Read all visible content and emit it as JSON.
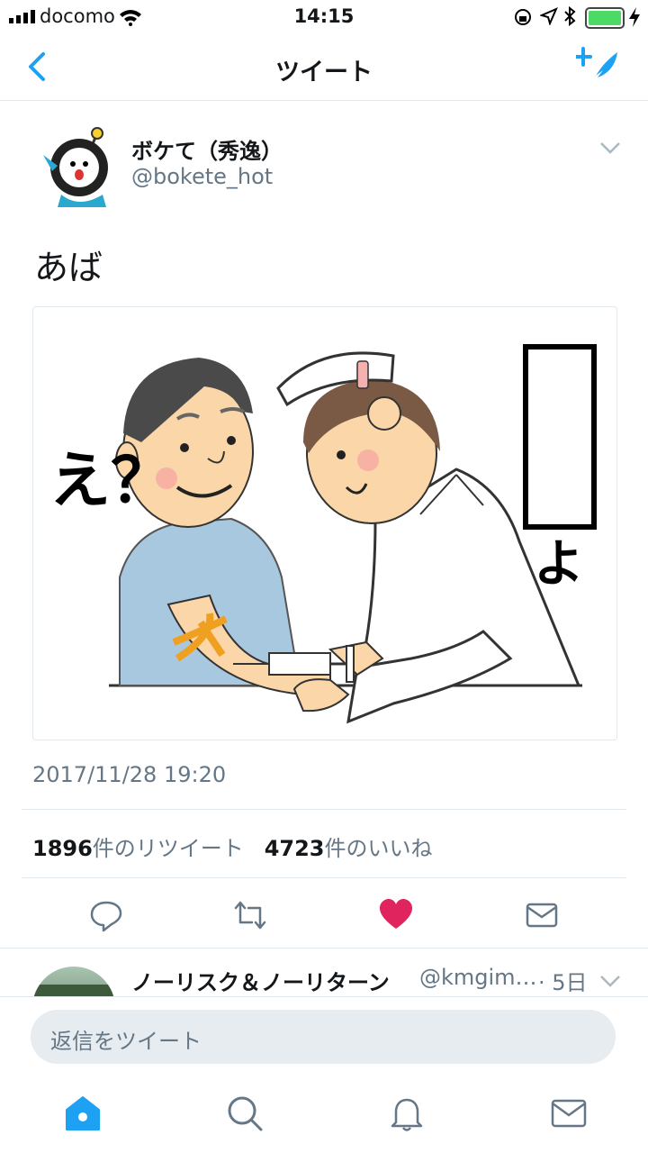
{
  "status_bar": {
    "carrier": "docomo",
    "time": "14:15"
  },
  "nav": {
    "title": "ツイート"
  },
  "tweet": {
    "display_name": "ボケて（秀逸）",
    "handle": "@bokete_hot",
    "text": "あば",
    "image_caption_left": "え？",
    "image_caption_right": "よ",
    "timestamp": "2017/11/28 19:20",
    "retweet_count": "1896",
    "retweet_label": "件のリツイート",
    "like_count": "4723",
    "like_label": "件のいいね"
  },
  "reply_preview": {
    "display_name": "ノーリスク＆ノーリターン",
    "handle": "@kmgim…",
    "time": "· 5日"
  },
  "composer": {
    "placeholder": "返信をツイート"
  },
  "colors": {
    "accent": "#1da1f2",
    "like": "#e0245e",
    "muted": "#657786"
  }
}
